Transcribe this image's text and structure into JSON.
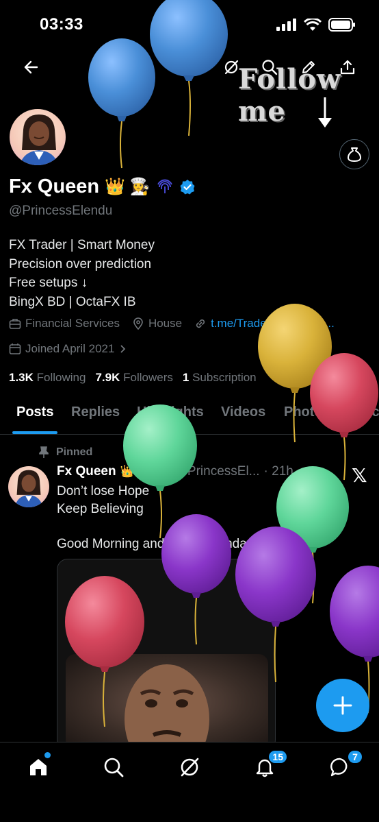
{
  "status_bar": {
    "time": "03:33"
  },
  "overlay": {
    "follow_text": "Follow me"
  },
  "profile": {
    "name": "Fx Queen",
    "name_emojis": "👑 👩‍🍳",
    "handle": "@PrincessElendu",
    "bio_lines": [
      "FX Trader | Smart Money",
      "Precision over prediction",
      "Free setups ↓",
      "BingX BD | OctaFX IB"
    ],
    "category": "Financial Services",
    "location": "House",
    "link": "t.me/TradeWithFxQue...",
    "joined": "Joined April 2021",
    "following_count": "1.3K",
    "following_label": "Following",
    "followers_count": "7.9K",
    "followers_label": "Followers",
    "subscription_count": "1",
    "subscription_label": "Subscription"
  },
  "tabs": [
    "Posts",
    "Replies",
    "Highlights",
    "Videos",
    "Photos",
    "Artic"
  ],
  "active_tab": "Posts",
  "post": {
    "pinned_label": "Pinned",
    "author": "Fx Queen",
    "author_emojis": "👑 👩‍🍳",
    "handle": "@PrincessEl...",
    "age": "· 21h",
    "lines": [
      "Don’t lose Hope",
      "Keep Believing",
      "",
      "Good Morning and Happy Sunday Fam"
    ]
  },
  "nav": {
    "notifications_badge": "15",
    "messages_badge": "7"
  },
  "icons": {
    "back": "back-arrow-icon",
    "grok": "grok-icon",
    "search": "search-icon",
    "edit": "edit-icon",
    "share": "share-icon",
    "money": "money-bag-icon",
    "verified": "verified-badge-icon",
    "home": "home-icon",
    "notifications": "bell-icon",
    "messages": "message-icon",
    "compose": "plus-icon"
  },
  "colors": {
    "accent": "#1d9bf0",
    "background": "#000000",
    "muted": "#71767b",
    "balloon_blue": "#4a8fd8",
    "balloon_yellow": "#d9b23a",
    "balloon_red": "#d6475e",
    "balloon_green": "#5fd69a",
    "balloon_purple": "#8a36c9"
  }
}
